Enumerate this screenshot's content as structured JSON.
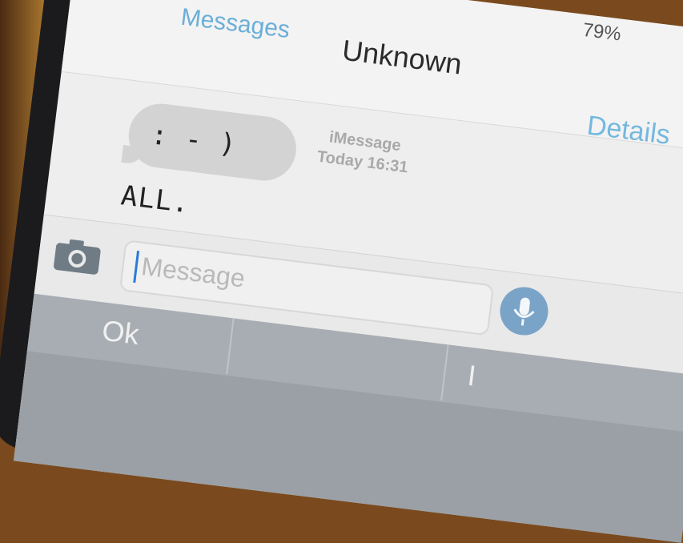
{
  "status": {
    "battery_text": "79%"
  },
  "nav": {
    "back_label": "Messages",
    "title": "Unknown",
    "details_label": "Details"
  },
  "thread": {
    "service": "iMessage",
    "timestamp": "Today 16:31",
    "messages": [
      {
        "from": "them",
        "text": ": - ) ALL."
      }
    ]
  },
  "composer": {
    "placeholder": "Message",
    "value": ""
  },
  "keyboard": {
    "suggestions": [
      "Ok",
      "",
      "I"
    ]
  },
  "colors": {
    "accent": "#6aaed8",
    "bubble_received": "#d3d3d3",
    "keyboard": "#a8adb3",
    "mic_button": "#7aa3c8"
  },
  "icons": {
    "camera": "camera-icon",
    "microphone": "microphone-icon"
  }
}
